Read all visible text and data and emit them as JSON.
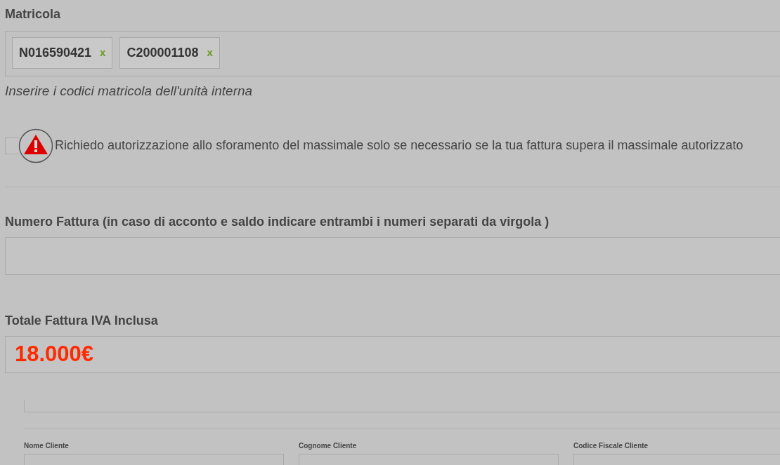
{
  "matricola": {
    "label": "Matricola",
    "tags": [
      {
        "text": "N016590421",
        "remove": "x"
      },
      {
        "text": "C200001108",
        "remove": "x"
      }
    ],
    "help": "Inserire i codici matricola dell'unità interna"
  },
  "authorization": {
    "checked": false,
    "label": "Richiedo autorizzazione allo sforamento del massimale solo se necessario se la tua fattura supera il massimale autorizzato"
  },
  "invoice_number": {
    "label": "Numero Fattura (in caso di acconto e saldo indicare entrambi i numeri separati da virgola )"
  },
  "invoice_total": {
    "label": "Totale Fattura IVA Inclusa",
    "value": "18.000€"
  },
  "customer_fields": [
    {
      "label": "Nome Cliente"
    },
    {
      "label": "Cognome Cliente"
    },
    {
      "label": "Codice Fiscale Cliente"
    }
  ]
}
